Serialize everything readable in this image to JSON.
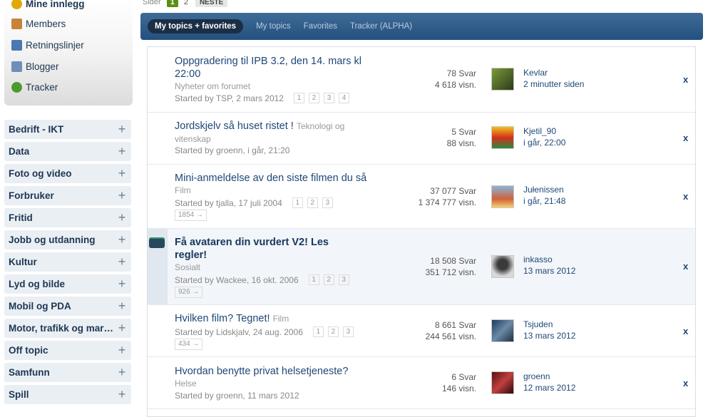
{
  "user_links": [
    {
      "label": "Mine innlegg",
      "icon": "smiley-icon",
      "color": "#e0a800"
    },
    {
      "label": "Members",
      "icon": "members-icon",
      "color": "#c9823b"
    },
    {
      "label": "Retningslinjer",
      "icon": "guidelines-icon",
      "color": "#4a78b0"
    },
    {
      "label": "Blogger",
      "icon": "blog-icon",
      "color": "#6f8fb8"
    },
    {
      "label": "Tracker",
      "icon": "bug-icon",
      "color": "#4a9b2f"
    }
  ],
  "categories": [
    "Bedrift - IKT",
    "Data",
    "Foto og video",
    "Forbruker",
    "Fritid",
    "Jobb og utdanning",
    "Kultur",
    "Lyd og bilde",
    "Mobil og PDA",
    "Motor, trafikk og mar…",
    "Off topic",
    "Samfunn",
    "Spill"
  ],
  "pagination": {
    "label": "Sider",
    "current": "1",
    "next_page": "2",
    "next_label": "NESTE"
  },
  "tabs": [
    "My topics + favorites",
    "My topics",
    "Favorites",
    "Tracker (ALPHA)"
  ],
  "colors": {
    "tab_bar": "#2b5785",
    "link": "#1e4778",
    "current_page": "#5b8f15"
  },
  "topics": [
    {
      "title": "Oppgradering til IPB 3.2, den 14. mars kl 22:00",
      "forum": "Nyheter om forumet",
      "forum_inline": false,
      "started": "Started by TSP, 2 mars 2012",
      "pages": [
        "1",
        "2",
        "3",
        "4"
      ],
      "last_page": "",
      "replies": "78 Svar",
      "views": "4 618 visn.",
      "last_poster": "Kevlar",
      "last_time": "2 minutter siden",
      "hot": false
    },
    {
      "title": "Jordskjelv så huset ristet !",
      "forum": "Teknologi og vitenskap",
      "forum_inline": true,
      "started": "Started by groenn, i går, 21:20",
      "pages": [],
      "last_page": "",
      "replies": "5 Svar",
      "views": "88 visn.",
      "last_poster": "Kjetil_90",
      "last_time": "i går, 22:00",
      "hot": false
    },
    {
      "title": "Mini-anmeldelse av den siste filmen du så",
      "forum": "Film",
      "forum_inline": false,
      "started": "Started by tjalla, 17 juli 2004",
      "pages": [
        "1",
        "2",
        "3"
      ],
      "last_page": "1854 →",
      "replies": "37 077 Svar",
      "views": "1 374 777 visn.",
      "last_poster": "Jułenissen",
      "last_time": "i går, 21:48",
      "hot": false
    },
    {
      "title": "Få avataren din vurdert V2! Les regler!",
      "forum": "Sosialt",
      "forum_inline": false,
      "started": "Started by Wackee, 16 okt. 2006",
      "pages": [
        "1",
        "2",
        "3"
      ],
      "last_page": "926 →",
      "replies": "18 508 Svar",
      "views": "351 712 visn.",
      "last_poster": "inkasso",
      "last_time": "13 mars 2012",
      "hot": true
    },
    {
      "title": "Hvilken film? Tegnet!",
      "forum": "Film",
      "forum_inline": true,
      "started": "Started by Lidskjalv, 24 aug. 2006",
      "pages": [
        "1",
        "2",
        "3"
      ],
      "last_page": "434 →",
      "replies": "8 661 Svar",
      "views": "244 561 visn.",
      "last_poster": "Tsjuden",
      "last_time": "13 mars 2012",
      "hot": false
    },
    {
      "title": "Hvordan benytte privat helsetjeneste?",
      "forum": "Helse",
      "forum_inline": false,
      "started": "Started by groenn, 11 mars 2012",
      "pages": [],
      "last_page": "",
      "replies": "6 Svar",
      "views": "146 visn.",
      "last_poster": "groenn",
      "last_time": "12 mars 2012",
      "hot": false
    }
  ],
  "close_label": "x"
}
